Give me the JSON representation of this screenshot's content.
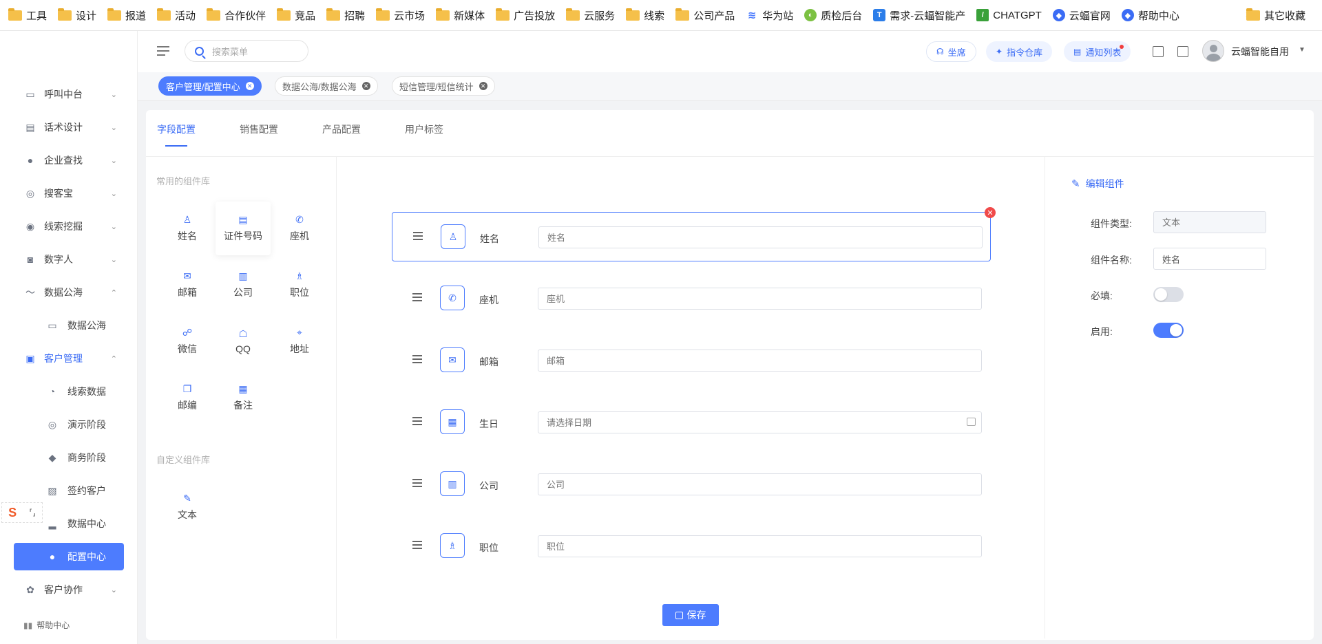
{
  "bookmarks": [
    {
      "label": "工具",
      "icon": "folder-icon"
    },
    {
      "label": "设计",
      "icon": "folder-icon"
    },
    {
      "label": "报道",
      "icon": "folder-icon"
    },
    {
      "label": "活动",
      "icon": "folder-icon"
    },
    {
      "label": "合作伙伴",
      "icon": "folder-icon"
    },
    {
      "label": "竞品",
      "icon": "folder-icon"
    },
    {
      "label": "招聘",
      "icon": "folder-icon"
    },
    {
      "label": "云市场",
      "icon": "folder-icon"
    },
    {
      "label": "新媒体",
      "icon": "folder-icon"
    },
    {
      "label": "广告投放",
      "icon": "folder-icon"
    },
    {
      "label": "云服务",
      "icon": "folder-icon"
    },
    {
      "label": "线索",
      "icon": "folder-icon"
    },
    {
      "label": "公司产品",
      "icon": "folder-icon"
    },
    {
      "label": "华为站",
      "icon": "layers-icon"
    },
    {
      "label": "质检后台",
      "icon": "tennis-ball-icon"
    },
    {
      "label": "需求-云蝠智能产",
      "icon": "t-logo-icon"
    },
    {
      "label": "CHATGPT",
      "icon": "slash-logo-icon"
    },
    {
      "label": "云蝠官网",
      "icon": "bat-logo-icon"
    },
    {
      "label": "帮助中心",
      "icon": "bat-logo-icon"
    }
  ],
  "bookmarks_more": "»",
  "bookmarks_other": "其它收藏",
  "sidebar": {
    "items": [
      {
        "label": "呼叫中台",
        "icon": "monitor-icon",
        "chevron": "⌄"
      },
      {
        "label": "话术设计",
        "icon": "book-icon",
        "chevron": "⌄"
      },
      {
        "label": "企业查找",
        "icon": "bulb-icon",
        "chevron": "⌄"
      },
      {
        "label": "搜客宝",
        "icon": "search-circle-icon",
        "chevron": "⌄"
      },
      {
        "label": "线索挖掘",
        "icon": "target-icon",
        "chevron": "⌄"
      },
      {
        "label": "数字人",
        "icon": "robot-icon",
        "chevron": "⌄"
      },
      {
        "label": "数据公海",
        "icon": "chart-icon",
        "chevron": "⌃"
      },
      {
        "label": "数据公海",
        "icon": "chart-icon"
      },
      {
        "label": "客户管理",
        "icon": "contacts-icon",
        "chevron": "⌃"
      },
      {
        "label": "线索数据",
        "icon": "user-search-icon"
      },
      {
        "label": "演示阶段",
        "icon": "circle-dot-icon"
      },
      {
        "label": "商务阶段",
        "icon": "diamond-icon"
      },
      {
        "label": "签约客户",
        "icon": "sign-icon"
      },
      {
        "label": "数据中心",
        "icon": "bar-chart-icon"
      },
      {
        "label": "配置中心",
        "icon": "user-gear-icon"
      },
      {
        "label": "客户协作",
        "icon": "team-icon",
        "chevron": "⌄"
      }
    ],
    "help": "帮助中心"
  },
  "header": {
    "search_placeholder": "搜索菜单",
    "seat": "坐席",
    "command": "指令仓库",
    "notice": "通知列表",
    "username": "云蝠智能自用"
  },
  "page_tabs": [
    {
      "label": "客户管理/配置中心",
      "active": true
    },
    {
      "label": "数据公海/数据公海",
      "active": false
    },
    {
      "label": "短信管理/短信统计",
      "active": false
    }
  ],
  "content_tabs": [
    "字段配置",
    "销售配置",
    "产品配置",
    "用户标签"
  ],
  "library": {
    "common_title": "常用的组件库",
    "common": [
      {
        "label": "姓名",
        "icon": "person-icon"
      },
      {
        "label": "证件号码",
        "icon": "id-card-icon"
      },
      {
        "label": "座机",
        "icon": "phone-icon"
      },
      {
        "label": "邮箱",
        "icon": "mail-icon"
      },
      {
        "label": "公司",
        "icon": "building-icon"
      },
      {
        "label": "职位",
        "icon": "tie-icon"
      },
      {
        "label": "微信",
        "icon": "wechat-icon"
      },
      {
        "label": "QQ",
        "icon": "qq-icon"
      },
      {
        "label": "地址",
        "icon": "location-icon"
      },
      {
        "label": "邮编",
        "icon": "open-book-icon"
      },
      {
        "label": "备注",
        "icon": "note-icon"
      }
    ],
    "custom_title": "自定义组件库",
    "custom": [
      {
        "label": "文本",
        "icon": "feather-icon"
      }
    ]
  },
  "form_fields": [
    {
      "label": "姓名",
      "placeholder": "姓名",
      "icon": "person-icon",
      "selected": true
    },
    {
      "label": "座机",
      "placeholder": "座机",
      "icon": "phone-icon"
    },
    {
      "label": "邮箱",
      "placeholder": "邮箱",
      "icon": "mail-icon"
    },
    {
      "label": "生日",
      "placeholder": "请选择日期",
      "icon": "calendar-icon"
    },
    {
      "label": "公司",
      "placeholder": "公司",
      "icon": "building-icon"
    },
    {
      "label": "职位",
      "placeholder": "职位",
      "icon": "tie-icon"
    }
  ],
  "save_label": "保存",
  "editor": {
    "title": "编辑组件",
    "type_label": "组件类型:",
    "type_value": "文本",
    "name_label": "组件名称:",
    "name_value": "姓名",
    "required_label": "必填:",
    "required": false,
    "enabled_label": "启用:",
    "enabled": true
  },
  "colors": {
    "primary": "#4d7cfe",
    "accent_text": "#3b6cf5",
    "danger": "#f04a4a"
  }
}
